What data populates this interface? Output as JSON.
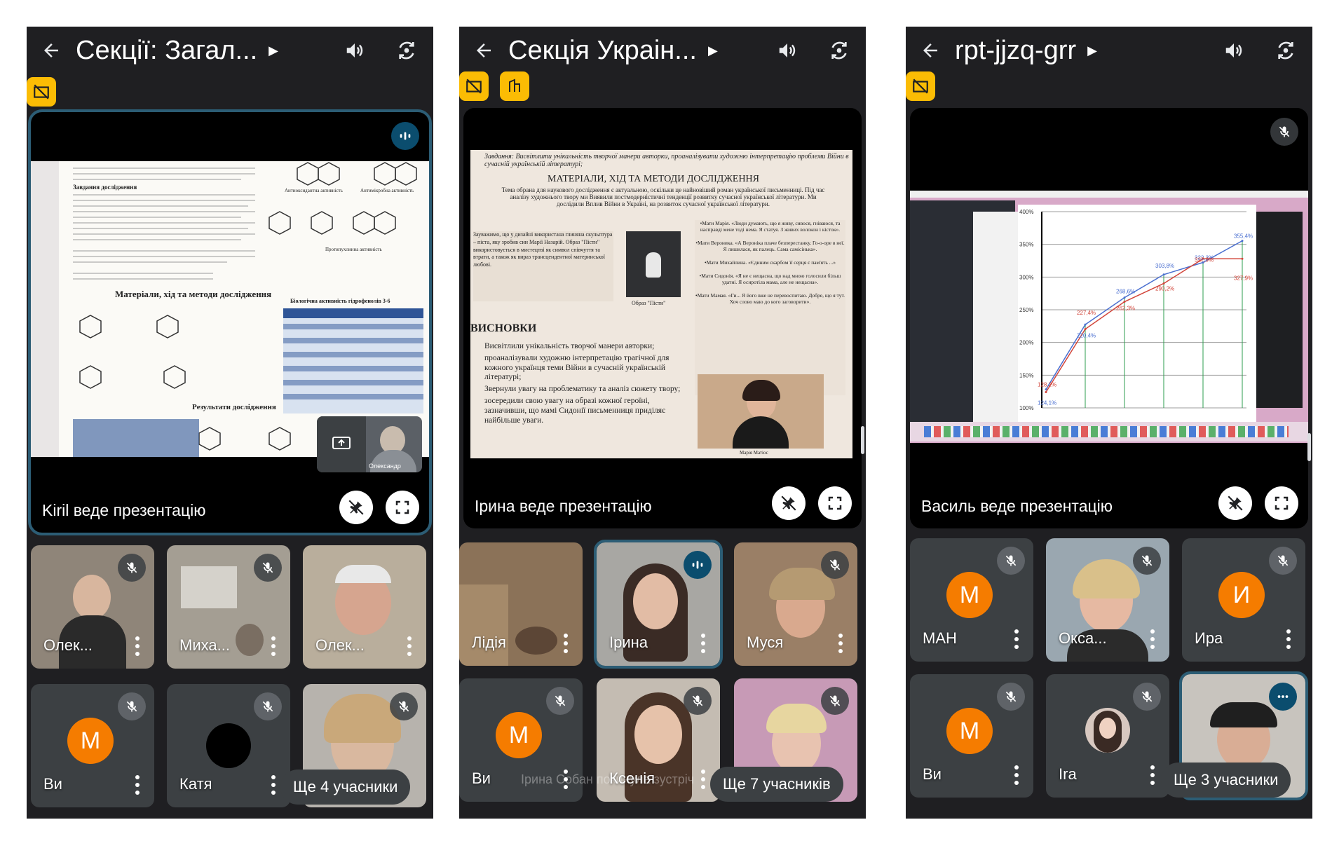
{
  "phones": [
    {
      "title": "Секції: Загал...",
      "caption": "Kiril веде презентацію",
      "slide": {
        "heading1": "Завдання дослідження",
        "heading2": "Матеріали, хід та методи дослідження",
        "heading3": "Біологічна активність гідрофенолів 3-6",
        "heading4": "Результати дослідження",
        "label1": "Антиоксидантна активність",
        "label2": "Антимікробна активність",
        "label3": "Протипухлинна активність",
        "pip_name": "Олександр"
      },
      "tiles": [
        {
          "name": "Олек..."
        },
        {
          "name": "Миха..."
        },
        {
          "name": "Олек..."
        },
        {
          "name": "Ви",
          "initial": "M"
        },
        {
          "name": "Катя"
        }
      ],
      "more": "Ще 4 учасники"
    },
    {
      "title": "Секція Украін...",
      "caption": "Ірина веде презентацію",
      "slide": {
        "task": "Завдання: Висвітлити унікальність творчої манери авторки, проаналізувати художню інтерпретацію проблеми Війни в сучасній українській літературі;",
        "heading": "МАТЕРІАЛИ, ХІД ТА МЕТОДИ ДОСЛІДЖЕННЯ",
        "intro": "Тема обрана для наукового дослідження є актуальною, оскільки це найновіший роман української письменниці. Під час аналізу художнього твору ми Виявили постмодерністичні тенденції розвитку сучасної української літератури. Ми дослідили Вплив Війни в Україні, на розвиток сучасної української літератури.",
        "left_para": "Зауважимо, що у дизайні використана глиняна скульптура – піста, яку зробив син Марії Назарій. Образ \"Пісти\" використовується в мистецтві як символ співчуття та втрати, а також як вираз трансцендентної материнської любові.",
        "image_caption": "Образ \"Пісти\"",
        "quote1": "•Мати Марія. «Люди думають, що я живу, сивося, гніваюся, та насправді мене тоді нема. Я статуя. З живих волокон і кісток».",
        "quote2": "•Мати Вероника. «А Вероніка плаче безперестанку. Го-о-оре в неї. Я лишилася, як палець. Сама самісінька».",
        "quote3": "•Мати Михайлина. «Єдиним скарбом її серця є пам'ять ...»",
        "quote4": "•Мати Сидонія. «Я не є нещасна, що над мною голосили більш удатні. Я осиротіла мама, але не нещасна».",
        "quote5": "•Мати Мамая. «Ги... Я його вже не перевоспитаю. Добре, що я тут. Хоч слово маю до кого заговорити».",
        "conclusions": "ВИСНОВКИ",
        "bullet1": "Висвітлили унікальність творчої манери авторки;",
        "bullet2": "проаналізували художню інтерпретацію трагічної для кожного українця теми Війни в сучасній українській літературі;",
        "bullet3": "Звернули увагу на проблематику та аналіз сюжету твору;",
        "bullet4": "зосередили свою увагу на образі кожної героїні, зазначивши, що мамі Сидонії письменниця приділяє найбільше уваги.",
        "photo_caption": "Марія Матіос"
      },
      "tiles": [
        {
          "name": "Лідія"
        },
        {
          "name": "Ірина"
        },
        {
          "name": "Муся"
        },
        {
          "name": "Ви",
          "initial": "M"
        },
        {
          "name": "Ксенія"
        }
      ],
      "more": "Ще 7 учасників",
      "overlay_text": "Ірина Собан покинула зустріч"
    },
    {
      "title": "rpt-jjzq-grr",
      "caption": "Василь веде презентацію",
      "chart_data": {
        "type": "line",
        "y_ticks": [
          "400%",
          "350%",
          "300%",
          "250%",
          "200%",
          "150%",
          "100%"
        ],
        "data_labels": [
          "128,2%",
          "124,1%",
          "227,4%",
          "220,4%",
          "268,6%",
          "303,8%",
          "290,2%",
          "262,3%",
          "322,3%",
          "327,9%",
          "355,4%",
          "327,9%"
        ],
        "series": [
          {
            "name": "",
            "values": [
              128.2,
              227.4,
              268.6,
              303.8,
              322.3,
              355.4
            ]
          },
          {
            "name": "",
            "values": [
              124.1,
              220.4,
              262.3,
              290.2,
              327.9,
              327.9
            ]
          }
        ]
      },
      "tiles": [
        {
          "name": "МАН",
          "initial": "M"
        },
        {
          "name": "Окса..."
        },
        {
          "name": "Ира",
          "initial": "И"
        },
        {
          "name": "Ви",
          "initial": "M"
        },
        {
          "name": "Ira"
        }
      ],
      "more": "Ще 3 учасники"
    }
  ],
  "colors": {
    "app_bg": "#1f1f22",
    "tile_bg": "#3c4043",
    "avatar_orange": "#f57c00",
    "badge_yellow": "#fbbc04",
    "active_border": "#2c5d75"
  }
}
